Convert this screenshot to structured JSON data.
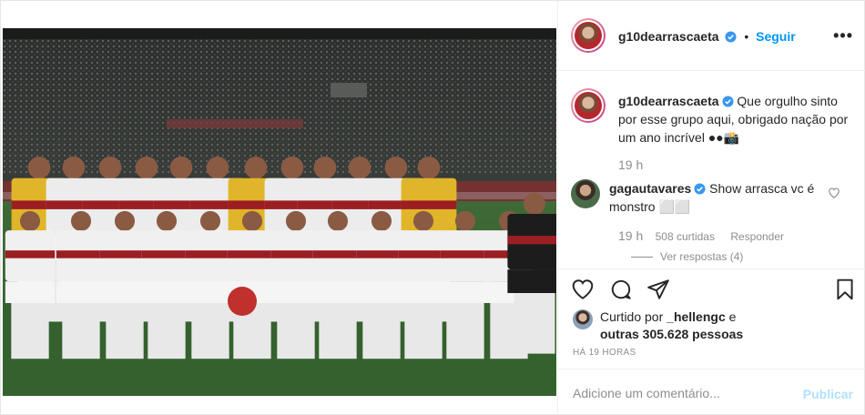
{
  "header": {
    "username": "g10dearrascaeta",
    "separator": "•",
    "follow_label": "Seguir",
    "more_label": "•••"
  },
  "caption": {
    "username": "g10dearrascaeta",
    "text": "Que orgulho sinto por esse grupo aqui, obrigado nação por um ano incrível ●●📸",
    "time": "19 h"
  },
  "comment": {
    "username": "gagautavares",
    "text": "Show arrasca vc é monstro ⬜⬜",
    "time": "19 h",
    "likes": "508 curtidas",
    "reply_label": "Responder",
    "view_replies": "Ver respostas (4)"
  },
  "likes": {
    "prefix": "Curtido por ",
    "user": "_hellengc",
    "suffix": " e",
    "others": "outras 305.628 pessoas"
  },
  "posted_ago": "HÁ 19 HORAS",
  "add_comment": {
    "placeholder": "Adicione um comentário...",
    "publish_label": "Publicar"
  },
  "icons": {
    "like": "heart-icon",
    "comment": "comment-bubble-icon",
    "share": "paper-plane-icon",
    "save": "bookmark-icon",
    "verified": "verified-badge-icon"
  },
  "colors": {
    "accent": "#0095f6",
    "muted": "#8e8e8e",
    "publish_disabled": "#b2dffc"
  }
}
